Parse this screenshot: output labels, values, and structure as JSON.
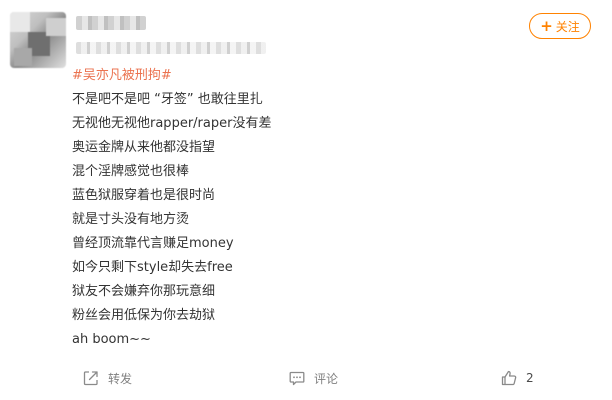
{
  "post": {
    "hashtag": "#吴亦凡被刑拘#",
    "lines": [
      "不是吧不是吧 “牙签” 也敢往里扎",
      "无视他无视他rapper/raper没有差",
      "奥运金牌从来他都没指望",
      "混个淫牌感觉也很棒",
      "蓝色狱服穿着也是很时尚",
      "就是寸头没有地方烫",
      "曾经顶流靠代言赚足money",
      "如今只剩下style却失去free",
      "狱友不会嫌弃你那玩意细",
      "粉丝会用低保为你去劫狱",
      "ah boom~~"
    ]
  },
  "header": {
    "follow_label": "关注"
  },
  "actions": {
    "forward_label": "转发",
    "comment_label": "评论",
    "like_count": "2"
  },
  "colors": {
    "accent": "#ff8200",
    "hashtag": "#eb7350",
    "text": "#333333",
    "muted": "#808080"
  },
  "icons": {
    "forward": "forward-icon",
    "comment": "comment-icon",
    "like": "thumbs-up-icon",
    "follow": "plus-icon"
  }
}
